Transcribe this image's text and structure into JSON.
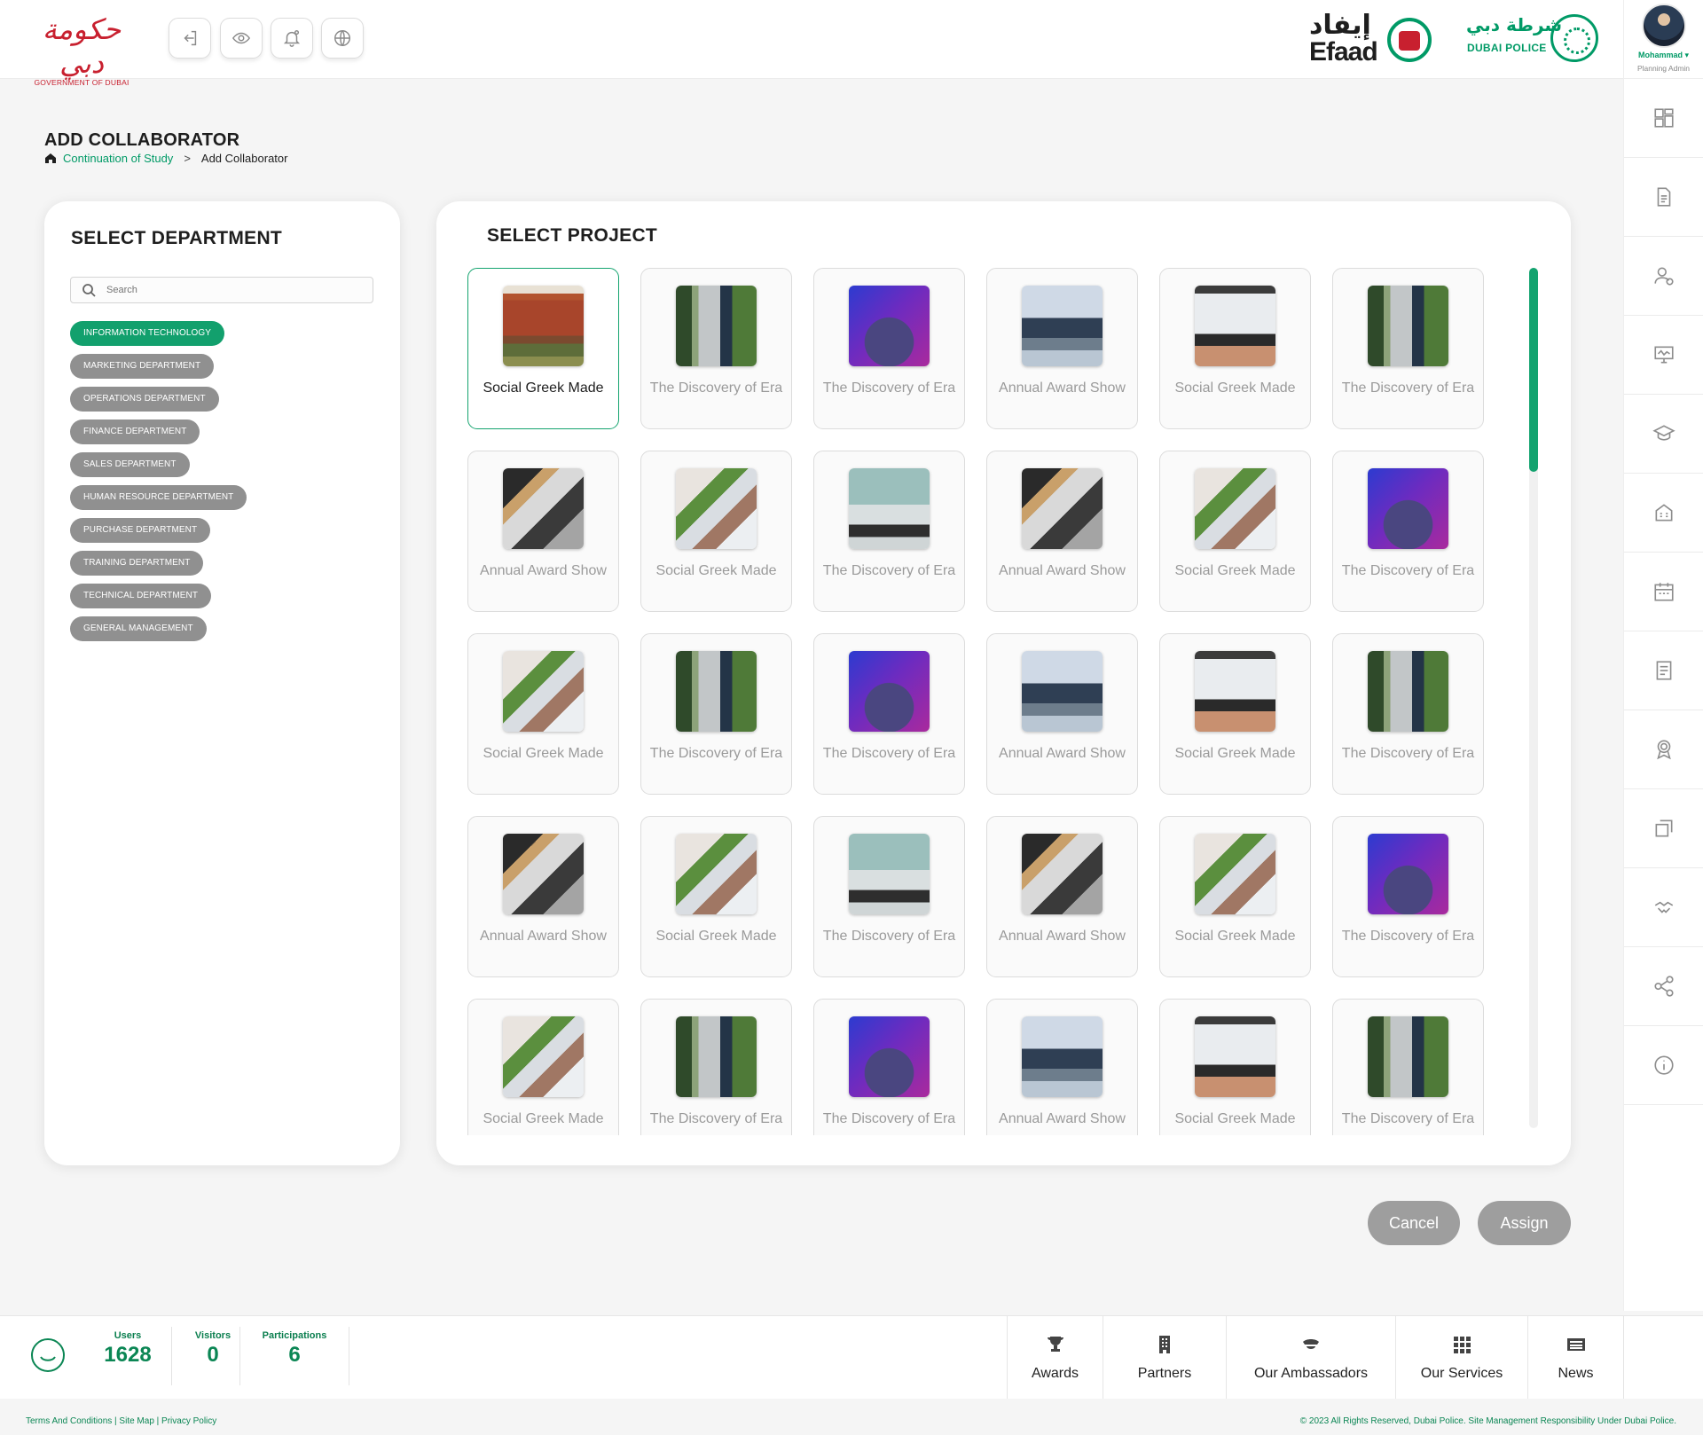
{
  "header": {
    "gov_logo_ar": "حكومة دبي",
    "gov_logo_en": "GOVERNMENT OF DUBAI",
    "efaad_ar": "إيفاد",
    "efaad_en": "Efaad",
    "police_ar": "شرطة دبي",
    "police_en": "DUBAI POLICE",
    "buttons": [
      "logout-icon",
      "eye-icon",
      "bell-icon",
      "globe-icon"
    ]
  },
  "profile": {
    "name": "Mohammad ▾",
    "role": "Planning Admin"
  },
  "sidebar_icons": [
    "dashboard-icon",
    "document-icon",
    "user-add-icon",
    "monitor-icon",
    "graduation-cap-icon",
    "building-icon",
    "calendar-icon",
    "notes-icon",
    "award-icon",
    "swap-icon",
    "handshake-icon",
    "share-icon",
    "info-icon"
  ],
  "page": {
    "title": "ADD COLLABORATOR",
    "breadcrumb": {
      "link": "Continuation of Study",
      "separator": ">",
      "current": "Add Collaborator"
    }
  },
  "department": {
    "title": "SELECT DEPARTMENT",
    "search_placeholder": "Search",
    "items": [
      {
        "label": "INFORMATION TECHNOLOGY",
        "active": true
      },
      {
        "label": "MARKETING DEPARTMENT",
        "active": false
      },
      {
        "label": "OPERATIONS DEPARTMENT",
        "active": false
      },
      {
        "label": "FINANCE DEPARTMENT",
        "active": false
      },
      {
        "label": "SALES DEPARTMENT",
        "active": false
      },
      {
        "label": "HUMAN RESOURCE DEPARTMENT",
        "active": false
      },
      {
        "label": "PURCHASE DEPARTMENT",
        "active": false
      },
      {
        "label": "TRAINING DEPARTMENT",
        "active": false
      },
      {
        "label": "TECHNICAL DEPARTMENT",
        "active": false
      },
      {
        "label": "GENERAL MANAGEMENT",
        "active": false
      }
    ]
  },
  "project": {
    "title": "SELECT PROJECT",
    "cards": [
      {
        "title": "Social Greek Made",
        "image": "house",
        "selected": true
      },
      {
        "title": "The Discovery of Era",
        "image": "city"
      },
      {
        "title": "The Discovery of Era",
        "image": "purple"
      },
      {
        "title": "Annual Award Show",
        "image": "office"
      },
      {
        "title": "Social Greek Made",
        "image": "laptop"
      },
      {
        "title": "The Discovery of Era",
        "image": "city"
      },
      {
        "title": "Annual Award Show",
        "image": "moto"
      },
      {
        "title": "Social Greek Made",
        "image": "high"
      },
      {
        "title": "The Discovery of Era",
        "image": "desk"
      },
      {
        "title": "Annual Award Show",
        "image": "moto"
      },
      {
        "title": "Social Greek Made",
        "image": "high"
      },
      {
        "title": "The Discovery of Era",
        "image": "purple"
      },
      {
        "title": "Social Greek Made",
        "image": "high"
      },
      {
        "title": "The Discovery of Era",
        "image": "city"
      },
      {
        "title": "The Discovery of Era",
        "image": "purple"
      },
      {
        "title": "Annual Award Show",
        "image": "office"
      },
      {
        "title": "Social Greek Made",
        "image": "laptop"
      },
      {
        "title": "The Discovery of Era",
        "image": "city"
      },
      {
        "title": "Annual Award Show",
        "image": "moto"
      },
      {
        "title": "Social Greek Made",
        "image": "high"
      },
      {
        "title": "The Discovery of Era",
        "image": "desk"
      },
      {
        "title": "Annual Award Show",
        "image": "moto"
      },
      {
        "title": "Social Greek Made",
        "image": "high"
      },
      {
        "title": "The Discovery of Era",
        "image": "purple"
      },
      {
        "title": "Social Greek Made",
        "image": "high"
      },
      {
        "title": "The Discovery of Era",
        "image": "city"
      },
      {
        "title": "The Discovery of Era",
        "image": "purple"
      },
      {
        "title": "Annual Award Show",
        "image": "office"
      },
      {
        "title": "Social Greek Made",
        "image": "laptop"
      },
      {
        "title": "The Discovery of Era",
        "image": "city"
      }
    ]
  },
  "actions": {
    "cancel": "Cancel",
    "assign": "Assign"
  },
  "stats": [
    {
      "label": "Users",
      "value": "1628"
    },
    {
      "label": "Visitors",
      "value": "0"
    },
    {
      "label": "Participations",
      "value": "6"
    }
  ],
  "footer_nav": [
    {
      "label": "Awards",
      "icon": "trophy-icon"
    },
    {
      "label": "Partners",
      "icon": "building-icon"
    },
    {
      "label": "Our Ambassadors",
      "icon": "ambassador-icon"
    },
    {
      "label": "Our Services",
      "icon": "grid-icon"
    },
    {
      "label": "News",
      "icon": "news-icon"
    }
  ],
  "bottom": {
    "links": "Terms And Conditions  |  Site Map  |  Privacy Policy",
    "copyright": "© 2023 All Rights Reserved, Dubai Police. Site Management Responsibility Under Dubai Police."
  },
  "colors": {
    "accent": "#12a06d",
    "chip_inactive": "#909090",
    "button_gray": "#9e9e9e",
    "brand_red": "#c8202f"
  }
}
